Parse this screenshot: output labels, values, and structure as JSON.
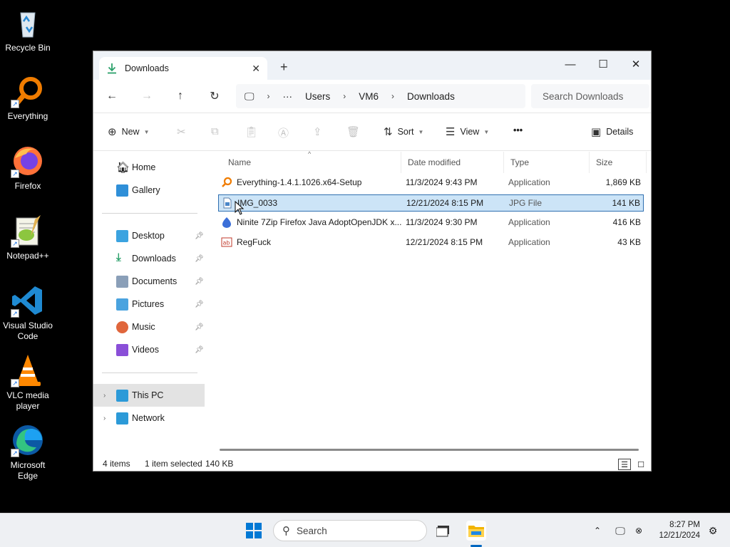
{
  "desktop": {
    "icons": [
      {
        "label": "Recycle Bin",
        "icon": "recycle-bin-icon"
      },
      {
        "label": "Everything",
        "icon": "everything-icon"
      },
      {
        "label": "Firefox",
        "icon": "firefox-icon"
      },
      {
        "label": "Notepad++",
        "icon": "notepadpp-icon"
      },
      {
        "label": "Visual Studio Code",
        "icon": "vscode-icon"
      },
      {
        "label": "VLC media player",
        "icon": "vlc-icon"
      },
      {
        "label": "Microsoft Edge",
        "icon": "edge-icon"
      }
    ]
  },
  "window": {
    "tab_title": "Downloads",
    "controls": {
      "minimize": "—",
      "maximize": "☐",
      "close": "✕"
    },
    "breadcrumb": [
      "Users",
      "VM6",
      "Downloads"
    ],
    "search_placeholder": "Search Downloads",
    "commands": {
      "new": "New",
      "sort": "Sort",
      "view": "View",
      "more": "•••",
      "details": "Details"
    },
    "sidebar": {
      "top": [
        {
          "label": "Home"
        },
        {
          "label": "Gallery"
        }
      ],
      "quick": [
        {
          "label": "Desktop"
        },
        {
          "label": "Downloads"
        },
        {
          "label": "Documents"
        },
        {
          "label": "Pictures"
        },
        {
          "label": "Music"
        },
        {
          "label": "Videos"
        }
      ],
      "bottom": [
        {
          "label": "This PC"
        },
        {
          "label": "Network"
        }
      ]
    },
    "columns": {
      "name": "Name",
      "date": "Date modified",
      "type": "Type",
      "size": "Size"
    },
    "files": [
      {
        "name": "Everything-1.4.1.1026.x64-Setup",
        "date": "11/3/2024 9:43 PM",
        "type": "Application",
        "size": "1,869 KB",
        "icon": "everything-installer-icon"
      },
      {
        "name": "IMG_0033",
        "date": "12/21/2024 8:15 PM",
        "type": "JPG File",
        "size": "141 KB",
        "icon": "image-file-icon"
      },
      {
        "name": "Ninite 7Zip Firefox Java AdoptOpenJDK x...",
        "date": "11/3/2024 9:30 PM",
        "type": "Application",
        "size": "416 KB",
        "icon": "ninite-icon"
      },
      {
        "name": "RegFuck",
        "date": "12/21/2024 8:15 PM",
        "type": "Application",
        "size": "43 KB",
        "icon": "application-icon"
      }
    ],
    "status": {
      "count": "4 items",
      "selected": "1 item selected",
      "size": "140 KB"
    }
  },
  "taskbar": {
    "search": "Search",
    "time": "8:27 PM",
    "date": "12/21/2024"
  },
  "colors": {
    "accent": "#0067c0",
    "selection": "#cce4f7",
    "taskbar": "#eef0f3"
  }
}
